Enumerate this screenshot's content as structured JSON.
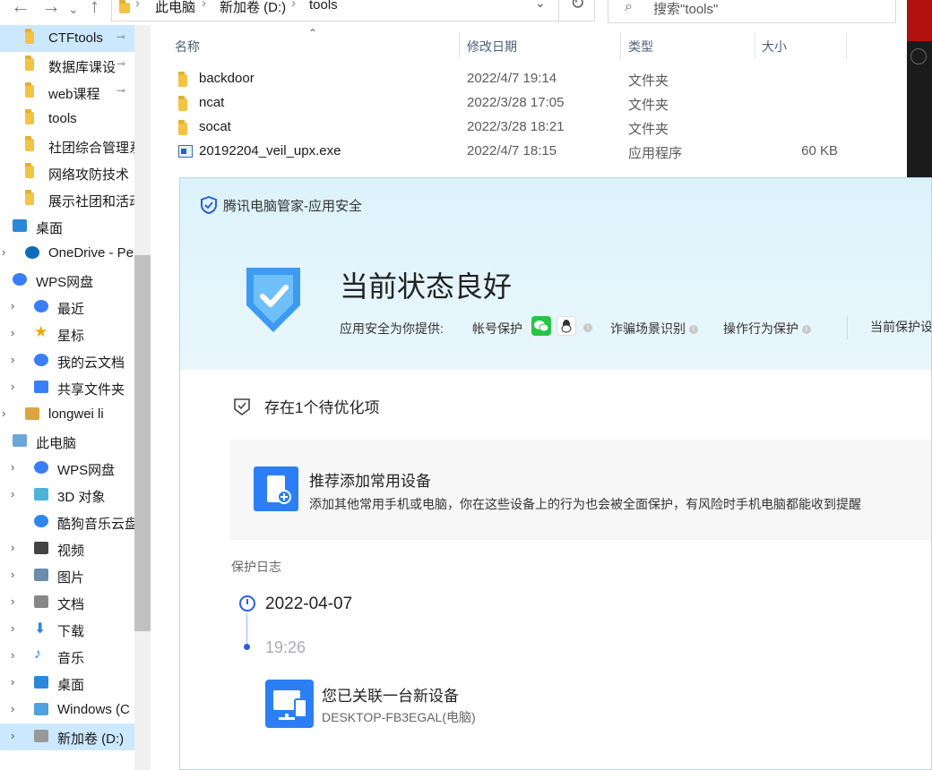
{
  "address_bar": {
    "segments": [
      "此电脑",
      "新加卷 (D:)",
      "tools"
    ],
    "search_placeholder": "搜索\"tools\""
  },
  "sidebar": {
    "items": [
      {
        "label": "CTFtools",
        "icon": "folder-icon",
        "pinned": true,
        "selected": true
      },
      {
        "label": "数据库课设",
        "icon": "folder-icon",
        "pinned": true
      },
      {
        "label": "web课程",
        "icon": "folder-icon",
        "pinned": true
      },
      {
        "label": "tools",
        "icon": "folder-icon"
      },
      {
        "label": "社团综合管理系",
        "icon": "folder-icon"
      },
      {
        "label": "网络攻防技术",
        "icon": "folder-icon"
      },
      {
        "label": "展示社团和活动",
        "icon": "folder-icon"
      },
      {
        "label": "桌面",
        "icon": "desktop-icon",
        "expanded": true
      },
      {
        "label": "OneDrive - Pe",
        "icon": "onedrive-icon"
      },
      {
        "label": "WPS网盘",
        "icon": "wps-cloud-icon",
        "expanded": true
      },
      {
        "label": "最近",
        "icon": "clock-icon"
      },
      {
        "label": "星标",
        "icon": "star-icon"
      },
      {
        "label": "我的云文档",
        "icon": "cloud-doc-icon"
      },
      {
        "label": "共享文件夹",
        "icon": "share-folder-icon"
      },
      {
        "label": "longwei li",
        "icon": "user-icon"
      },
      {
        "label": "此电脑",
        "icon": "computer-icon",
        "expanded": true
      },
      {
        "label": "WPS网盘",
        "icon": "wps-cloud-icon"
      },
      {
        "label": "3D 对象",
        "icon": "cube-icon"
      },
      {
        "label": "酷狗音乐云盘",
        "icon": "kugou-icon"
      },
      {
        "label": "视频",
        "icon": "video-icon"
      },
      {
        "label": "图片",
        "icon": "picture-icon"
      },
      {
        "label": "文档",
        "icon": "document-icon"
      },
      {
        "label": "下载",
        "icon": "download-icon"
      },
      {
        "label": "音乐",
        "icon": "music-icon"
      },
      {
        "label": "桌面",
        "icon": "desktop-icon"
      },
      {
        "label": "Windows (C",
        "icon": "windows-drive-icon"
      },
      {
        "label": "新加卷 (D:)",
        "icon": "drive-icon",
        "selected": true
      }
    ]
  },
  "file_list": {
    "columns": [
      "名称",
      "修改日期",
      "类型",
      "大小"
    ],
    "rows": [
      {
        "name": "backdoor",
        "date": "2022/4/7 19:14",
        "type": "文件夹",
        "size": "",
        "icon": "folder-icon"
      },
      {
        "name": "ncat",
        "date": "2022/3/28 17:05",
        "type": "文件夹",
        "size": "",
        "icon": "folder-icon"
      },
      {
        "name": "socat",
        "date": "2022/3/28 18:21",
        "type": "文件夹",
        "size": "",
        "icon": "folder-icon"
      },
      {
        "name": "20192204_veil_upx.exe",
        "date": "2022/4/7 18:15",
        "type": "应用程序",
        "size": "60 KB",
        "icon": "exe-icon"
      }
    ]
  },
  "popup": {
    "brand": "腾讯电脑管家-应用安全",
    "status": "当前状态良好",
    "provides_label": "应用安全为你提供:",
    "features": [
      "帐号保护",
      "诈骗场景识别",
      "操作行为保护"
    ],
    "current_protect": "当前保护设",
    "optimize_text": "存在1个待优化项",
    "card": {
      "title": "推荐添加常用设备",
      "desc": "添加其他常用手机或电脑，你在这些设备上的行为也会被全面保护，有风险时手机电脑都能收到提醒"
    },
    "log_header": "保护日志",
    "log": {
      "date": "2022-04-07",
      "time": "19:26",
      "event_title": "您已关联一台新设备",
      "event_sub": "DESKTOP-FB3EGAL(电脑)"
    },
    "colors": {
      "accent": "#2b7ef4",
      "hero_bg": "#dcf2fb",
      "wechat": "#28c446"
    }
  }
}
